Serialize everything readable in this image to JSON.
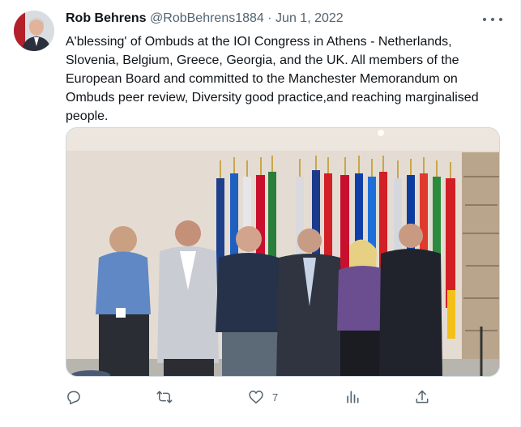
{
  "tweet": {
    "author_name": "Rob Behrens",
    "handle": "@RobBehrens1884",
    "separator": "·",
    "date": "Jun 1, 2022",
    "text_lines": [
      "A'blessing' of Ombuds at the IOI Congress in Athens - Netherlands,",
      "Slovenia, Belgium, Greece, Georgia, and the UK. All members of the",
      "European Board and committed to the  Manchester Memorandum on",
      "Ombuds peer review, Diversity good practice,and  reaching marginalised",
      "people."
    ]
  },
  "actions": {
    "reply": {
      "icon": "reply-icon",
      "count": ""
    },
    "retweet": {
      "icon": "retweet-icon",
      "count": ""
    },
    "like": {
      "icon": "heart-icon",
      "count": "7"
    },
    "views": {
      "icon": "analytics-icon",
      "count": ""
    },
    "share": {
      "icon": "share-icon",
      "count": ""
    }
  },
  "colors": {
    "text_primary": "#0f1419",
    "text_secondary": "#536471",
    "border": "#cfd9de"
  }
}
